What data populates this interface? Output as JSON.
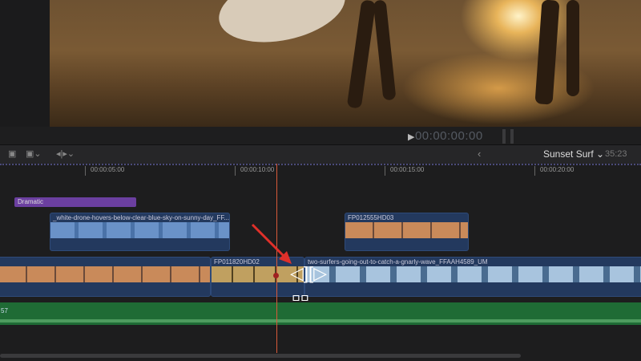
{
  "viewer": {
    "timecode": "00:00:00:00",
    "play_icon": "▶"
  },
  "toolbar": {
    "back": "‹",
    "project_name": "Sunset Surf ⌄",
    "duration": "35:23",
    "icons": [
      "clip-appearance-icon",
      "append-icon",
      "trim-tool-icon"
    ]
  },
  "ruler": {
    "labels": [
      "00:00:05:00",
      "00:00:10:00",
      "00:00:15:00",
      "00:00:20:00"
    ]
  },
  "timeline": {
    "title_clip": "Dramatic",
    "connected_clips": [
      "_white-drone-hovers-below-clear-blue-sky-on-sunny-day_FF...",
      "FP012555HD03"
    ],
    "primary_clips": [
      "",
      "FP011820HD02",
      "two-surfers-going-out-to-catch-a-gnarly-wave_FFAAH4589_UM"
    ],
    "audio_label": "57"
  },
  "colors": {
    "playhead": "#d85a3a",
    "title": "#6b3fa0",
    "clip": "#23395e",
    "audio": "#1f6b35"
  }
}
